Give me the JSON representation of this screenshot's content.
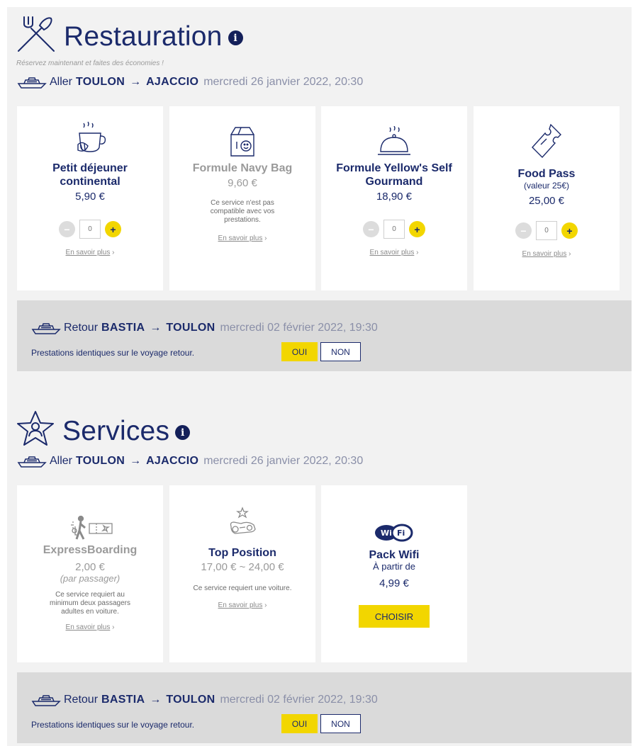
{
  "restauration": {
    "title": "Restauration",
    "subtitle": "Réservez maintenant et faites des économies !",
    "aller": {
      "label": "Aller",
      "from": "TOULON",
      "to": "AJACCIO",
      "date": "mercredi 26 janvier 2022, 20:30"
    },
    "cards": [
      {
        "name": "Petit déjeuner continental",
        "price": "5,90 €",
        "qty": "0",
        "more": "En savoir plus",
        "icon": "coffee-croissant-icon"
      },
      {
        "name": "Formule Navy Bag",
        "price": "9,60 €",
        "note": "Ce service n'est pas compatible avec vos prestations.",
        "more": "En savoir plus",
        "icon": "navy-bag-icon"
      },
      {
        "name": "Formule Yellow's Self Gourmand",
        "price": "18,90 €",
        "qty": "0",
        "more": "En savoir plus",
        "icon": "cloche-icon"
      },
      {
        "name": "Food Pass",
        "sub": "(valeur 25€)",
        "price": "25,00 €",
        "qty": "0",
        "more": "En savoir plus",
        "icon": "ticket-icon"
      }
    ],
    "retour": {
      "label": "Retour",
      "from": "BASTIA",
      "to": "TOULON",
      "date": "mercredi 02 février 2022, 19:30",
      "identical": "Prestations identiques sur le voyage retour.",
      "yes": "OUI",
      "no": "NON"
    }
  },
  "services": {
    "title": "Services",
    "aller": {
      "label": "Aller",
      "from": "TOULON",
      "to": "AJACCIO",
      "date": "mercredi 26 janvier 2022, 20:30"
    },
    "cards": [
      {
        "name": "ExpressBoarding",
        "price": "2,00 €",
        "sub": "(par passager)",
        "note": "Ce service requiert au minimum deux passagers adultes en voiture.",
        "more": "En savoir plus",
        "icon": "express-boarding-icon"
      },
      {
        "name": "Top Position",
        "price": "17,00 € ~ 24,00 €",
        "note": "Ce service requiert une voiture.",
        "more": "En savoir plus",
        "icon": "car-star-icon"
      },
      {
        "name": "Pack Wifi",
        "sub": "À partir de",
        "price": "4,99 €",
        "button": "CHOISIR",
        "icon": "wifi-icon",
        "wifi_logo": "Wi Fi"
      }
    ],
    "retour": {
      "label": "Retour",
      "from": "BASTIA",
      "to": "TOULON",
      "date": "mercredi 02 février 2022, 19:30",
      "identical": "Prestations identiques sur le voyage retour.",
      "yes": "OUI",
      "no": "NON"
    }
  },
  "ui": {
    "arrow": "→",
    "minus": "−",
    "plus": "+",
    "chevron": "›",
    "info": "i"
  },
  "colors": {
    "navy": "#1b2a6b",
    "yellow": "#f2d600",
    "panel": "#f2f2f2",
    "retour_bg": "#dadada"
  }
}
